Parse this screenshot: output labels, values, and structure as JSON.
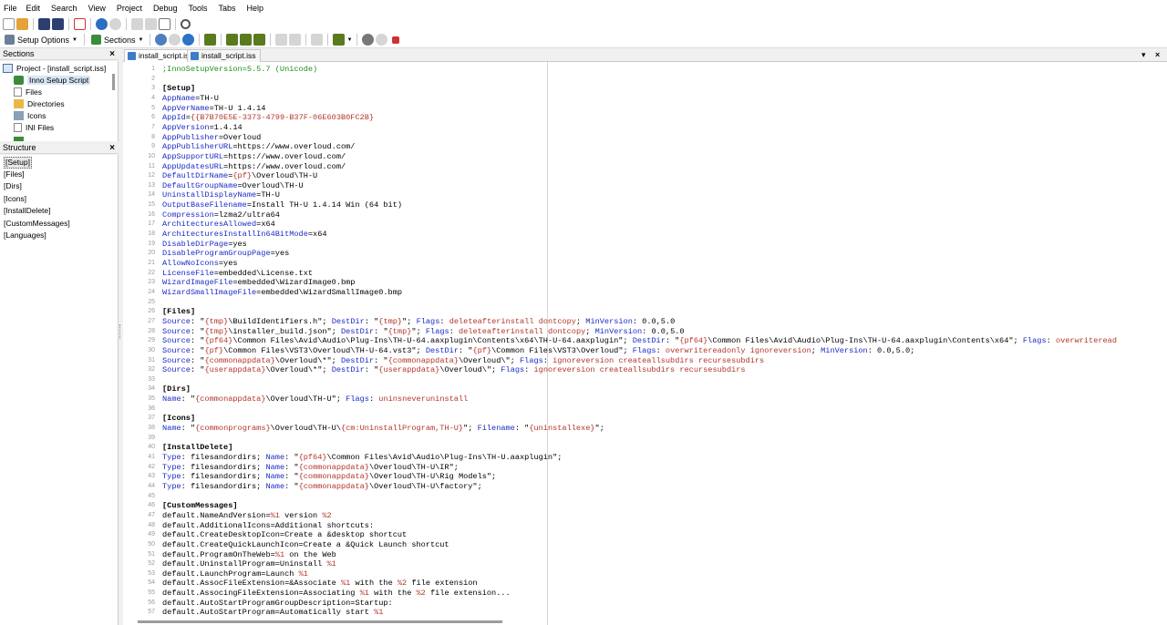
{
  "menubar": [
    "File",
    "Edit",
    "Search",
    "View",
    "Project",
    "Debug",
    "Tools",
    "Tabs",
    "Help"
  ],
  "toolbar": {
    "setup_options_label": "Setup Options",
    "sections_label": "Sections"
  },
  "sections_pane": {
    "title": "Sections",
    "close": "×",
    "items": [
      {
        "label": "Project - [install_script.iss]"
      },
      {
        "label": "Inno Setup Script"
      },
      {
        "label": "Files"
      },
      {
        "label": "Directories"
      },
      {
        "label": "Icons"
      },
      {
        "label": "INI Files"
      }
    ]
  },
  "structure_pane": {
    "title": "Structure",
    "close": "×",
    "items": [
      "[Setup]",
      "[Files]",
      "[Dirs]",
      "[Icons]",
      "[InstallDelete]",
      "[CustomMessages]",
      "[Languages]"
    ]
  },
  "tabs": [
    {
      "label": "install_script.iss"
    },
    {
      "label": "install_script.iss"
    }
  ],
  "editor": {
    "lines": [
      [
        [
          "c",
          ";InnoSetupVersion=5.5.7 (Unicode)"
        ]
      ],
      [],
      [
        [
          "s",
          "[Setup]"
        ]
      ],
      [
        [
          "k",
          "AppName"
        ],
        [
          "v",
          "=TH-U"
        ]
      ],
      [
        [
          "k",
          "AppVerName"
        ],
        [
          "v",
          "=TH-U 1.4.14"
        ]
      ],
      [
        [
          "k",
          "AppId"
        ],
        [
          "v",
          "="
        ],
        [
          "cn",
          "{{B7B70E5E-3373-4799-B37F-06E603B0FC2B}"
        ]
      ],
      [
        [
          "k",
          "AppVersion"
        ],
        [
          "v",
          "=1.4.14"
        ]
      ],
      [
        [
          "k",
          "AppPublisher"
        ],
        [
          "v",
          "=Overloud"
        ]
      ],
      [
        [
          "k",
          "AppPublisherURL"
        ],
        [
          "v",
          "=https://www.overloud.com/"
        ]
      ],
      [
        [
          "k",
          "AppSupportURL"
        ],
        [
          "v",
          "=https://www.overloud.com/"
        ]
      ],
      [
        [
          "k",
          "AppUpdatesURL"
        ],
        [
          "v",
          "=https://www.overloud.com/"
        ]
      ],
      [
        [
          "k",
          "DefaultDirName"
        ],
        [
          "v",
          "="
        ],
        [
          "cn",
          "{pf}"
        ],
        [
          "v",
          "\\Overloud\\TH-U"
        ]
      ],
      [
        [
          "k",
          "DefaultGroupName"
        ],
        [
          "v",
          "=Overloud\\TH-U"
        ]
      ],
      [
        [
          "k",
          "UninstallDisplayName"
        ],
        [
          "v",
          "=TH-U"
        ]
      ],
      [
        [
          "k",
          "OutputBaseFilename"
        ],
        [
          "v",
          "=Install TH-U 1.4.14 Win (64 bit)"
        ]
      ],
      [
        [
          "k",
          "Compression"
        ],
        [
          "v",
          "=lzma2/ultra64"
        ]
      ],
      [
        [
          "k",
          "ArchitecturesAllowed"
        ],
        [
          "v",
          "=x64"
        ]
      ],
      [
        [
          "k",
          "ArchitecturesInstallIn64BitMode"
        ],
        [
          "v",
          "=x64"
        ]
      ],
      [
        [
          "k",
          "DisableDirPage"
        ],
        [
          "v",
          "=yes"
        ]
      ],
      [
        [
          "k",
          "DisableProgramGroupPage"
        ],
        [
          "v",
          "=yes"
        ]
      ],
      [
        [
          "k",
          "AllowNoIcons"
        ],
        [
          "v",
          "=yes"
        ]
      ],
      [
        [
          "k",
          "LicenseFile"
        ],
        [
          "v",
          "=embedded\\License.txt"
        ]
      ],
      [
        [
          "k",
          "WizardImageFile"
        ],
        [
          "v",
          "=embedded\\WizardImage0.bmp"
        ]
      ],
      [
        [
          "k",
          "WizardSmallImageFile"
        ],
        [
          "v",
          "=embedded\\WizardSmallImage0.bmp"
        ]
      ],
      [],
      [
        [
          "s",
          "[Files]"
        ]
      ],
      [
        [
          "k",
          "Source"
        ],
        [
          "v",
          ": \""
        ],
        [
          "cn",
          "{tmp}"
        ],
        [
          "v",
          "\\BuildIdentifiers.h\"; "
        ],
        [
          "k",
          "DestDir"
        ],
        [
          "v",
          ": \""
        ],
        [
          "cn",
          "{tmp}"
        ],
        [
          "v",
          "\"; "
        ],
        [
          "k",
          "Flags"
        ],
        [
          "v",
          ": "
        ],
        [
          "f",
          "deleteafterinstall dontcopy"
        ],
        [
          "v",
          "; "
        ],
        [
          "k",
          "MinVersion"
        ],
        [
          "v",
          ": 0.0,5.0"
        ]
      ],
      [
        [
          "k",
          "Source"
        ],
        [
          "v",
          ": \""
        ],
        [
          "cn",
          "{tmp}"
        ],
        [
          "v",
          "\\installer_build.json\"; "
        ],
        [
          "k",
          "DestDir"
        ],
        [
          "v",
          ": \""
        ],
        [
          "cn",
          "{tmp}"
        ],
        [
          "v",
          "\"; "
        ],
        [
          "k",
          "Flags"
        ],
        [
          "v",
          ": "
        ],
        [
          "f",
          "deleteafterinstall dontcopy"
        ],
        [
          "v",
          "; "
        ],
        [
          "k",
          "MinVersion"
        ],
        [
          "v",
          ": 0.0,5.0"
        ]
      ],
      [
        [
          "k",
          "Source"
        ],
        [
          "v",
          ": \""
        ],
        [
          "cn",
          "{pf64}"
        ],
        [
          "v",
          "\\Common Files\\Avid\\Audio\\Plug-Ins\\TH-U-64.aaxplugin\\Contents\\x64\\TH-U-64.aaxplugin\"; "
        ],
        [
          "k",
          "DestDir"
        ],
        [
          "v",
          ": \""
        ],
        [
          "cn",
          "{pf64}"
        ],
        [
          "v",
          "\\Common Files\\Avid\\Audio\\Plug-Ins\\TH-U-64.aaxplugin\\Contents\\x64\"; "
        ],
        [
          "k",
          "Flags"
        ],
        [
          "v",
          ": "
        ],
        [
          "f",
          "overwriteread"
        ]
      ],
      [
        [
          "k",
          "Source"
        ],
        [
          "v",
          ": \""
        ],
        [
          "cn",
          "{pf}"
        ],
        [
          "v",
          "\\Common Files\\VST3\\Overloud\\TH-U-64.vst3\"; "
        ],
        [
          "k",
          "DestDir"
        ],
        [
          "v",
          ": \""
        ],
        [
          "cn",
          "{pf}"
        ],
        [
          "v",
          "\\Common Files\\VST3\\Overloud\"; "
        ],
        [
          "k",
          "Flags"
        ],
        [
          "v",
          ": "
        ],
        [
          "f",
          "overwritereadonly ignoreversion"
        ],
        [
          "v",
          "; "
        ],
        [
          "k",
          "MinVersion"
        ],
        [
          "v",
          ": 0.0,5.0;"
        ]
      ],
      [
        [
          "k",
          "Source"
        ],
        [
          "v",
          ": \""
        ],
        [
          "cn",
          "{commonappdata}"
        ],
        [
          "v",
          "\\Overloud\\*\"; "
        ],
        [
          "k",
          "DestDir"
        ],
        [
          "v",
          ": \""
        ],
        [
          "cn",
          "{commonappdata}"
        ],
        [
          "v",
          "\\Overloud\\\"; "
        ],
        [
          "k",
          "Flags"
        ],
        [
          "v",
          ": "
        ],
        [
          "f",
          "ignoreversion createallsubdirs recursesubdirs"
        ]
      ],
      [
        [
          "k",
          "Source"
        ],
        [
          "v",
          ": \""
        ],
        [
          "cn",
          "{userappdata}"
        ],
        [
          "v",
          "\\Overloud\\*\"; "
        ],
        [
          "k",
          "DestDir"
        ],
        [
          "v",
          ": \""
        ],
        [
          "cn",
          "{userappdata}"
        ],
        [
          "v",
          "\\Overloud\\\"; "
        ],
        [
          "k",
          "Flags"
        ],
        [
          "v",
          ": "
        ],
        [
          "f",
          "ignoreversion createallsubdirs recursesubdirs"
        ]
      ],
      [],
      [
        [
          "s",
          "[Dirs]"
        ]
      ],
      [
        [
          "k",
          "Name"
        ],
        [
          "v",
          ": \""
        ],
        [
          "cn",
          "{commonappdata}"
        ],
        [
          "v",
          "\\Overloud\\TH-U\"; "
        ],
        [
          "k",
          "Flags"
        ],
        [
          "v",
          ": "
        ],
        [
          "f",
          "uninsneveruninstall"
        ]
      ],
      [],
      [
        [
          "s",
          "[Icons]"
        ]
      ],
      [
        [
          "k",
          "Name"
        ],
        [
          "v",
          ": \""
        ],
        [
          "cn",
          "{commonprograms}"
        ],
        [
          "v",
          "\\Overloud\\TH-U\\"
        ],
        [
          "cn",
          "{cm:UninstallProgram,TH-U}"
        ],
        [
          "v",
          "\"; "
        ],
        [
          "k",
          "Filename"
        ],
        [
          "v",
          ": \""
        ],
        [
          "cn",
          "{uninstallexe}"
        ],
        [
          "v",
          "\";"
        ]
      ],
      [],
      [
        [
          "s",
          "[InstallDelete]"
        ]
      ],
      [
        [
          "k",
          "Type"
        ],
        [
          "v",
          ": filesandordirs; "
        ],
        [
          "k",
          "Name"
        ],
        [
          "v",
          ": \""
        ],
        [
          "cn",
          "{pf64}"
        ],
        [
          "v",
          "\\Common Files\\Avid\\Audio\\Plug-Ins\\TH-U.aaxplugin\";"
        ]
      ],
      [
        [
          "k",
          "Type"
        ],
        [
          "v",
          ": filesandordirs; "
        ],
        [
          "k",
          "Name"
        ],
        [
          "v",
          ": \""
        ],
        [
          "cn",
          "{commonappdata}"
        ],
        [
          "v",
          "\\Overloud\\TH-U\\IR\";"
        ]
      ],
      [
        [
          "k",
          "Type"
        ],
        [
          "v",
          ": filesandordirs; "
        ],
        [
          "k",
          "Name"
        ],
        [
          "v",
          ": \""
        ],
        [
          "cn",
          "{commonappdata}"
        ],
        [
          "v",
          "\\Overloud\\TH-U\\Rig Models\";"
        ]
      ],
      [
        [
          "k",
          "Type"
        ],
        [
          "v",
          ": filesandordirs; "
        ],
        [
          "k",
          "Name"
        ],
        [
          "v",
          ": \""
        ],
        [
          "cn",
          "{commonappdata}"
        ],
        [
          "v",
          "\\Overloud\\TH-U\\factory\";"
        ]
      ],
      [],
      [
        [
          "s",
          "[CustomMessages]"
        ]
      ],
      [
        [
          "v",
          "default.NameAndVersion="
        ],
        [
          "cn",
          "%1"
        ],
        [
          "v",
          " version "
        ],
        [
          "cn",
          "%2"
        ]
      ],
      [
        [
          "v",
          "default.AdditionalIcons=Additional shortcuts:"
        ]
      ],
      [
        [
          "v",
          "default.CreateDesktopIcon=Create a &desktop shortcut"
        ]
      ],
      [
        [
          "v",
          "default.CreateQuickLaunchIcon=Create a &Quick Launch shortcut"
        ]
      ],
      [
        [
          "v",
          "default.ProgramOnTheWeb="
        ],
        [
          "cn",
          "%1"
        ],
        [
          "v",
          " on the Web"
        ]
      ],
      [
        [
          "v",
          "default.UninstallProgram=Uninstall "
        ],
        [
          "cn",
          "%1"
        ]
      ],
      [
        [
          "v",
          "default.LaunchProgram=Launch "
        ],
        [
          "cn",
          "%1"
        ]
      ],
      [
        [
          "v",
          "default.AssocFileExtension=&Associate "
        ],
        [
          "cn",
          "%1"
        ],
        [
          "v",
          " with the "
        ],
        [
          "cn",
          "%2"
        ],
        [
          "v",
          " file extension"
        ]
      ],
      [
        [
          "v",
          "default.AssocingFileExtension=Associating "
        ],
        [
          "cn",
          "%1"
        ],
        [
          "v",
          " with the "
        ],
        [
          "cn",
          "%2"
        ],
        [
          "v",
          " file extension..."
        ]
      ],
      [
        [
          "v",
          "default.AutoStartProgramGroupDescription=Startup:"
        ]
      ],
      [
        [
          "v",
          "default.AutoStartProgram=Automatically start "
        ],
        [
          "cn",
          "%1"
        ]
      ]
    ]
  },
  "colors": {
    "key": "#1a2bc5",
    "constant": "#b3362a",
    "comment": "#1f8f1f"
  }
}
